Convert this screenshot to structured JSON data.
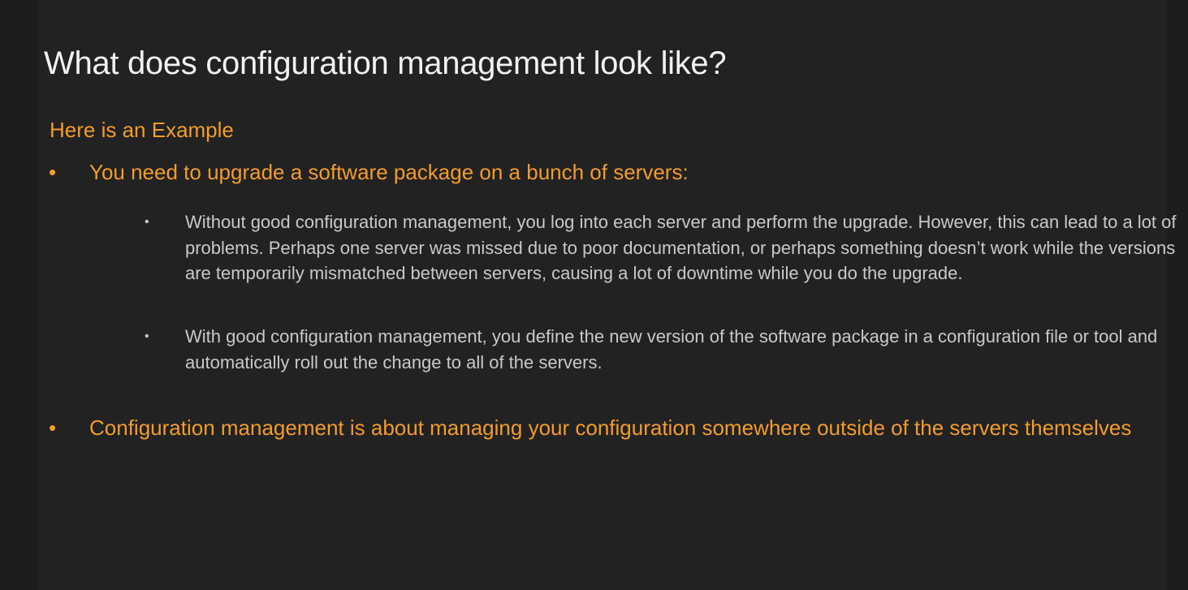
{
  "slide": {
    "title": "What does configuration management look like?",
    "subtitle": "Here is an Example",
    "bullets": [
      {
        "marker": "•",
        "text": "You need to upgrade a software package on a bunch of servers:"
      },
      {
        "marker": "•",
        "text": "Configuration management is about managing your configuration somewhere outside of the servers themselves"
      }
    ],
    "sub_bullets": [
      {
        "marker": "•",
        "text": "Without good configuration management, you log into each server and perform the upgrade. However, this can lead to a lot of problems. Perhaps one server was missed due to poor documentation, or perhaps something doesn’t work while the versions are temporarily mismatched between servers, causing a lot of downtime while you do the upgrade."
      },
      {
        "marker": "•",
        "text": "With good configuration management, you define the new version of the software package in a configuration file or tool and automatically roll out the change to all of the servers."
      }
    ]
  },
  "colors": {
    "background": "#222222",
    "title": "#f2f2f2",
    "accent": "#f39c2b",
    "body_text": "#c9c9c9"
  }
}
